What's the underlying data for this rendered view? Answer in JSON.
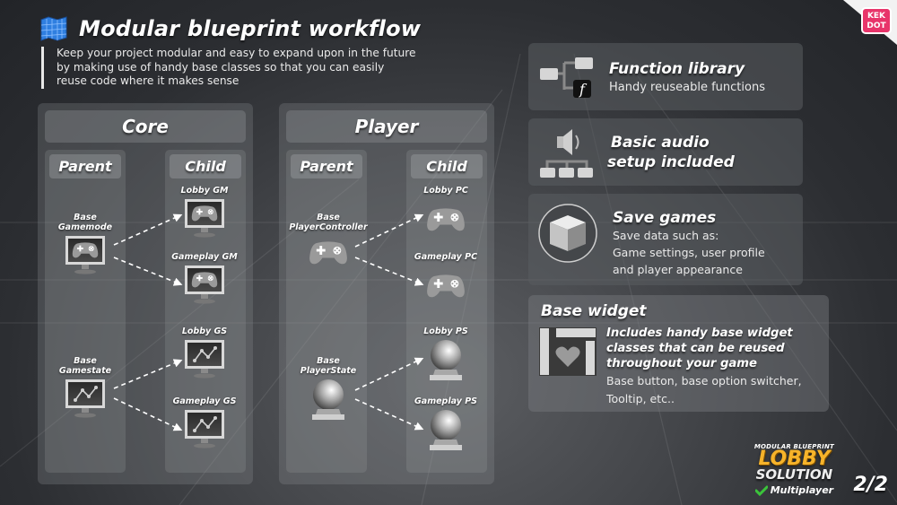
{
  "header": {
    "title": "Modular blueprint workflow",
    "icon": "blueprint-map-icon",
    "intro_lines": [
      "Keep your project modular and easy to expand upon in the future",
      "by making use of handy base classes so that you can easily",
      "reuse code where it makes sense"
    ]
  },
  "groups": [
    {
      "title": "Core",
      "parent_label": "Parent",
      "child_label": "Child",
      "parents": [
        {
          "label_lines": [
            "Base",
            "Gamemode"
          ],
          "icon": "monitor-gamepad-icon"
        },
        {
          "label_lines": [
            "Base",
            "Gamestate"
          ],
          "icon": "monitor-chart-icon"
        }
      ],
      "children": [
        {
          "label": "Lobby GM",
          "icon": "monitor-gamepad-icon"
        },
        {
          "label": "Gameplay GM",
          "icon": "monitor-gamepad-icon"
        },
        {
          "label": "Lobby GS",
          "icon": "monitor-chart-icon"
        },
        {
          "label": "Gameplay GS",
          "icon": "monitor-chart-icon"
        }
      ]
    },
    {
      "title": "Player",
      "parent_label": "Parent",
      "child_label": "Child",
      "parents": [
        {
          "label_lines": [
            "Base",
            "PlayerController"
          ],
          "icon": "gamepad-icon"
        },
        {
          "label_lines": [
            "Base",
            "PlayerState"
          ],
          "icon": "sphere-pedestal-icon"
        }
      ],
      "children": [
        {
          "label": "Lobby PC",
          "icon": "gamepad-icon"
        },
        {
          "label": "Gameplay PC",
          "icon": "gamepad-icon"
        },
        {
          "label": "Lobby PS",
          "icon": "sphere-pedestal-icon"
        },
        {
          "label": "Gameplay PS",
          "icon": "sphere-pedestal-icon"
        }
      ]
    }
  ],
  "features": [
    {
      "title": "Function library",
      "lines": [
        "Handy reuseable functions"
      ],
      "icon": "function-tree-icon"
    },
    {
      "title_lines": [
        "Basic audio",
        "setup included"
      ],
      "icon": "audio-tree-icon"
    },
    {
      "title": "Save games",
      "lines": [
        "Save data such as:",
        "Game settings, user profile",
        "and player appearance"
      ],
      "icon": "cube-icon"
    },
    {
      "title": "Base widget",
      "subtitle_lines": [
        "Includes handy base widget",
        "classes that can be reused",
        "throughout your game"
      ],
      "lines": [
        "Base button, base option switcher,",
        "Tooltip, etc.."
      ],
      "icon": "widget-heart-icon"
    }
  ],
  "logo": {
    "top": "MODULAR BLUEPRINT",
    "line1": "LOBBY",
    "line2": "SOLUTION",
    "tag": "Multiplayer"
  },
  "brand": {
    "line1": "KEK",
    "line2": "DOT"
  },
  "page": "2/2",
  "colors": {
    "accent": "#f6b32a",
    "brand": "#e8346a",
    "check": "#3bc43b",
    "blueprint": "#2f7fe0"
  }
}
